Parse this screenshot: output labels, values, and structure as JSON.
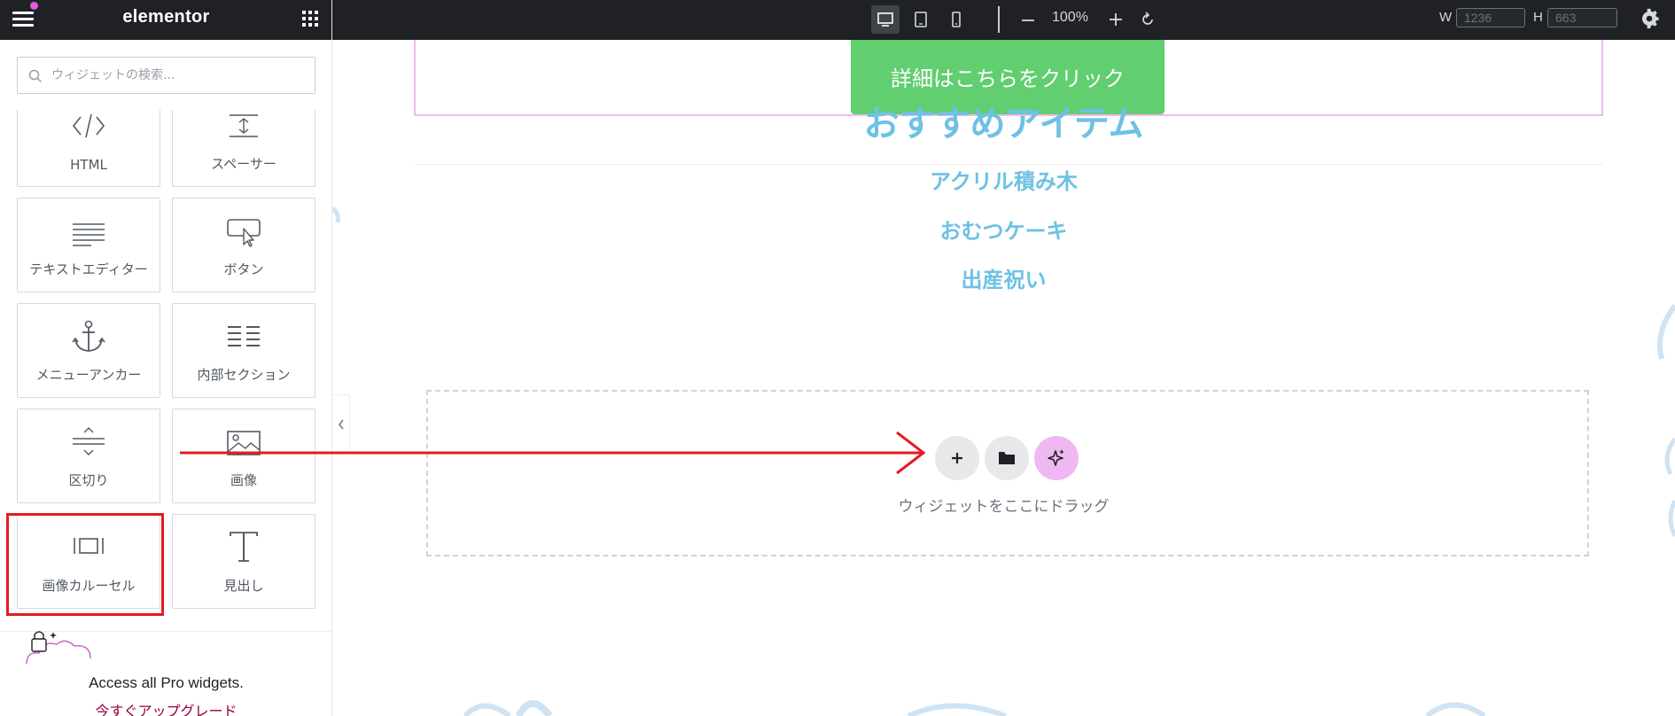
{
  "app": {
    "logo": "elementor"
  },
  "sidebar": {
    "search_placeholder": "ウィジェットの検索...",
    "widgets": [
      {
        "label": "HTML",
        "icon": "code-icon"
      },
      {
        "label": "スペーサー",
        "icon": "spacer-icon"
      },
      {
        "label": "テキストエディター",
        "icon": "text-editor-icon"
      },
      {
        "label": "ボタン",
        "icon": "button-icon"
      },
      {
        "label": "メニューアンカー",
        "icon": "anchor-icon"
      },
      {
        "label": "内部セクション",
        "icon": "inner-section-icon"
      },
      {
        "label": "区切り",
        "icon": "divider-icon"
      },
      {
        "label": "画像",
        "icon": "image-icon"
      },
      {
        "label": "画像カルーセル",
        "icon": "carousel-icon"
      },
      {
        "label": "見出し",
        "icon": "heading-icon"
      }
    ],
    "promo_text": "Access all Pro widgets.",
    "promo_link": "今すぐアップグレード"
  },
  "topbar": {
    "zoom": "100%",
    "width_label": "W",
    "width_value": "1236",
    "height_label": "H",
    "height_value": "663"
  },
  "canvas": {
    "cta_button": "詳細はこちらをクリック",
    "heading": "おすすめアイテム",
    "items": [
      "アクリル積み木",
      "おむつケーキ",
      "出産祝い"
    ],
    "drop_text": "ウィジェットをここにドラッグ"
  },
  "colors": {
    "accent_heading": "#6ec1e4",
    "cta_green": "#61ce70",
    "annotation_red": "#e31b23",
    "ai_button": "#f0b8f3"
  }
}
